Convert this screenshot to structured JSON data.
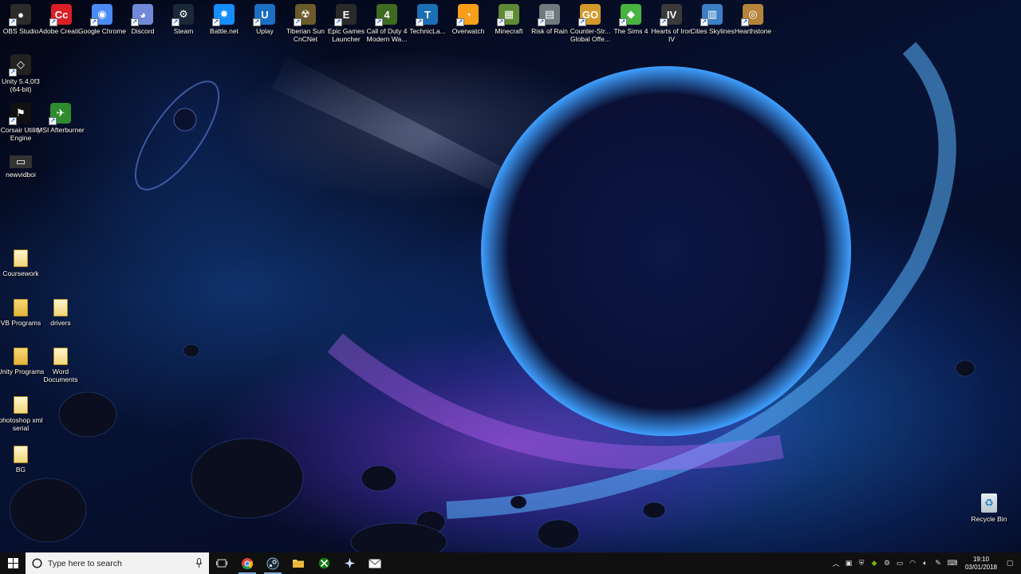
{
  "desktop": {
    "top_row": [
      {
        "name": "obs-studio-icon",
        "label": "OBS Studio",
        "color": "#2b2b2b",
        "glyph": "●"
      },
      {
        "name": "adobe-creative-cloud-icon",
        "label": "Adobe Creati...",
        "color": "#da1f26",
        "glyph": "Cc"
      },
      {
        "name": "google-chrome-icon",
        "label": "Google Chrome",
        "color": "#4a8af4",
        "glyph": "◉"
      },
      {
        "name": "discord-icon",
        "label": "Discord",
        "color": "#7289da",
        "glyph": "◕"
      },
      {
        "name": "steam-icon",
        "label": "Steam",
        "color": "#1b2838",
        "glyph": "⚙"
      },
      {
        "name": "battlenet-icon",
        "label": "Battle.net",
        "color": "#148eff",
        "glyph": "✸"
      },
      {
        "name": "uplay-icon",
        "label": "Uplay",
        "color": "#1b6fc4",
        "glyph": "U"
      },
      {
        "name": "tiberian-sun-icon",
        "label": "Tiberian Sun CnCNet",
        "color": "#6b5a2a",
        "glyph": "☢"
      },
      {
        "name": "epic-games-icon",
        "label": "Epic Games Launcher",
        "color": "#2a2a2a",
        "glyph": "E"
      },
      {
        "name": "call-of-duty-icon",
        "label": "Call of Duty 4 Modern Wa...",
        "color": "#3e6b1f",
        "glyph": "4"
      },
      {
        "name": "technic-launcher-icon",
        "label": "TechnicLa...",
        "color": "#1a6fb5",
        "glyph": "T"
      },
      {
        "name": "overwatch-icon",
        "label": "Overwatch",
        "color": "#f99e1a",
        "glyph": "◔"
      },
      {
        "name": "minecraft-icon",
        "label": "Minecraft",
        "color": "#5d8a34",
        "glyph": "▦"
      },
      {
        "name": "risk-of-rain-icon",
        "label": "Risk of Rain",
        "color": "#6d7b7d",
        "glyph": "▤"
      },
      {
        "name": "counter-strike-icon",
        "label": "Counter-Str... Global Offe...",
        "color": "#d29a2a",
        "glyph": "GO"
      },
      {
        "name": "the-sims-4-icon",
        "label": "The Sims 4",
        "color": "#47b341",
        "glyph": "◆"
      },
      {
        "name": "hearts-of-iron-icon",
        "label": "Hearts of Iron IV",
        "color": "#3a3a3a",
        "glyph": "IV"
      },
      {
        "name": "cities-skylines-icon",
        "label": "Cities Skylines",
        "color": "#3d7fc7",
        "glyph": "▥"
      },
      {
        "name": "hearthstone-icon",
        "label": "Hearthstone",
        "color": "#b58339",
        "glyph": "◎"
      }
    ],
    "left_column": {
      "unity": {
        "label": "Unity 5.4.0f3 (64-bit)",
        "color": "#222",
        "glyph": "◇"
      },
      "corsair": {
        "label": "Corsair Utility Engine",
        "color": "#111",
        "glyph": "⚑"
      },
      "msi": {
        "label": "MSI Afterburner",
        "color": "#2e8b2e",
        "glyph": "✈"
      },
      "newvidboi": {
        "label": "newvidboi",
        "color": "#333",
        "glyph": "▭"
      },
      "coursework": {
        "label": "Coursework"
      },
      "vb_programs": {
        "label": "VB Programs"
      },
      "drivers": {
        "label": "drivers"
      },
      "unity_programs": {
        "label": "Unity Programs"
      },
      "word_documents": {
        "label": "Word Documents"
      },
      "photoshop_serial": {
        "label": "photoshop xml serial"
      },
      "bg": {
        "label": "BG"
      }
    },
    "recycle_bin": {
      "label": "Recycle Bin"
    }
  },
  "taskbar": {
    "search_placeholder": "Type here to search",
    "clock_time": "19:10",
    "clock_date": "03/01/2018",
    "colors": {
      "bar": "#101010",
      "search_bg": "#f2f2f2",
      "accent": "#7aa7d8"
    }
  }
}
